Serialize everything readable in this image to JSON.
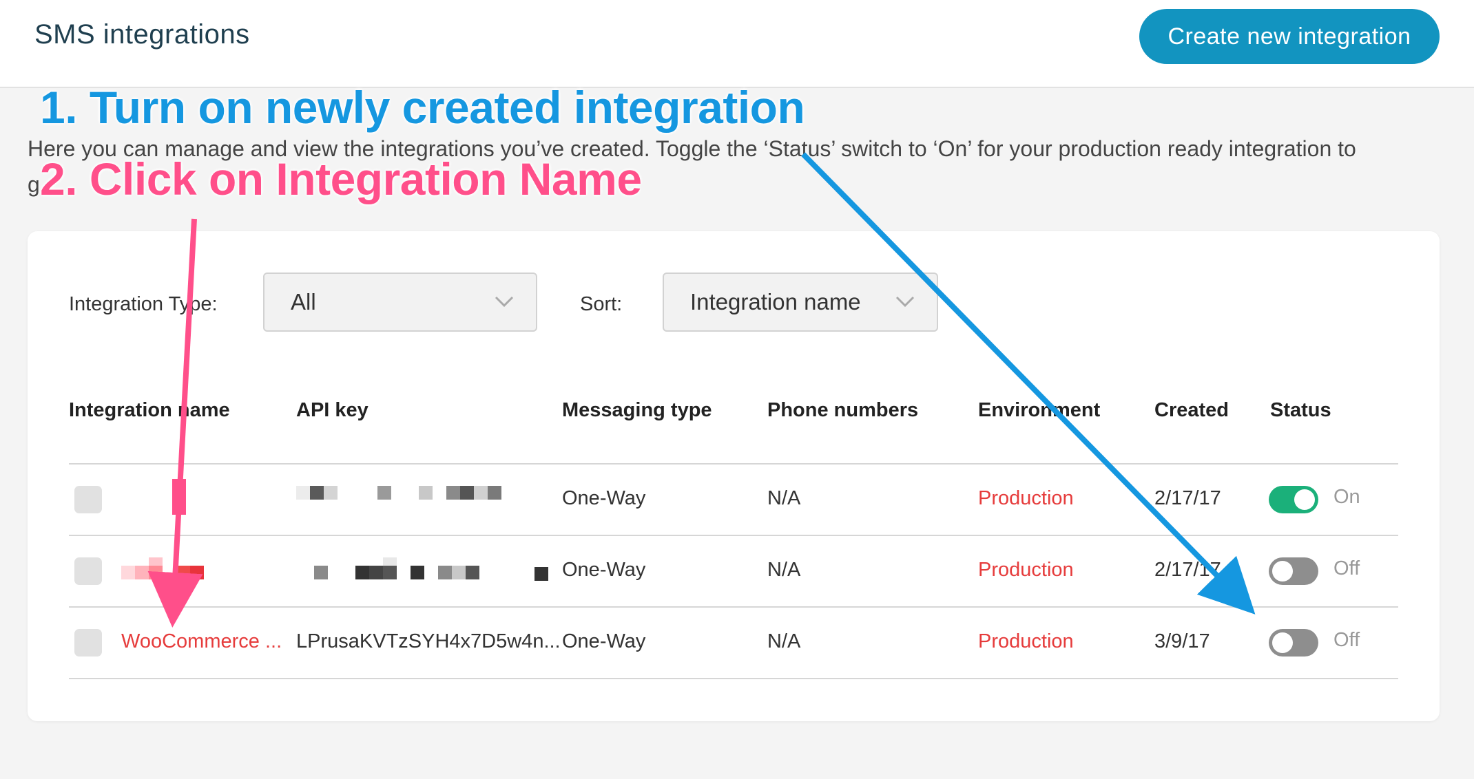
{
  "header": {
    "title": "SMS integrations",
    "create_button": "Create new integration"
  },
  "intro": "Here you can manage and view the integrations you’ve created. Toggle the ‘Status’ switch to ‘On’ for your production ready integration to",
  "intro_line2": "g",
  "filters": {
    "type_label": "Integration Type:",
    "type_value": "All",
    "sort_label": "Sort:",
    "sort_value": "Integration name"
  },
  "table": {
    "headers": [
      "Integration name",
      "API key",
      "Messaging type",
      "Phone numbers",
      "Environment",
      "Created",
      "Status"
    ],
    "rows": [
      {
        "name": "",
        "api_key": "",
        "messaging": "One-Way",
        "phones": "N/A",
        "env": "Production",
        "created": "2/17/17",
        "status": "On",
        "on": true
      },
      {
        "name": "",
        "api_key": "",
        "messaging": "One-Way",
        "phones": "N/A",
        "env": "Production",
        "created": "2/17/17",
        "status": "Off",
        "on": false
      },
      {
        "name": "WooCommerce ...",
        "api_key": "LPrusaKVTzSYH4x7D5w4n...",
        "messaging": "One-Way",
        "phones": "N/A",
        "env": "Production",
        "created": "3/9/17",
        "status": "Off",
        "on": false
      }
    ]
  },
  "annotations": {
    "step1": "1. Turn on newly created integration",
    "step2": "2. Click on Integration Name"
  },
  "colors": {
    "primary": "#1294c0",
    "toggle_on": "#1bb07a",
    "toggle_off": "#8e8e8e",
    "production": "#e63c3c",
    "annotation_blue": "#1597e0",
    "annotation_pink": "#ff4f8a"
  }
}
